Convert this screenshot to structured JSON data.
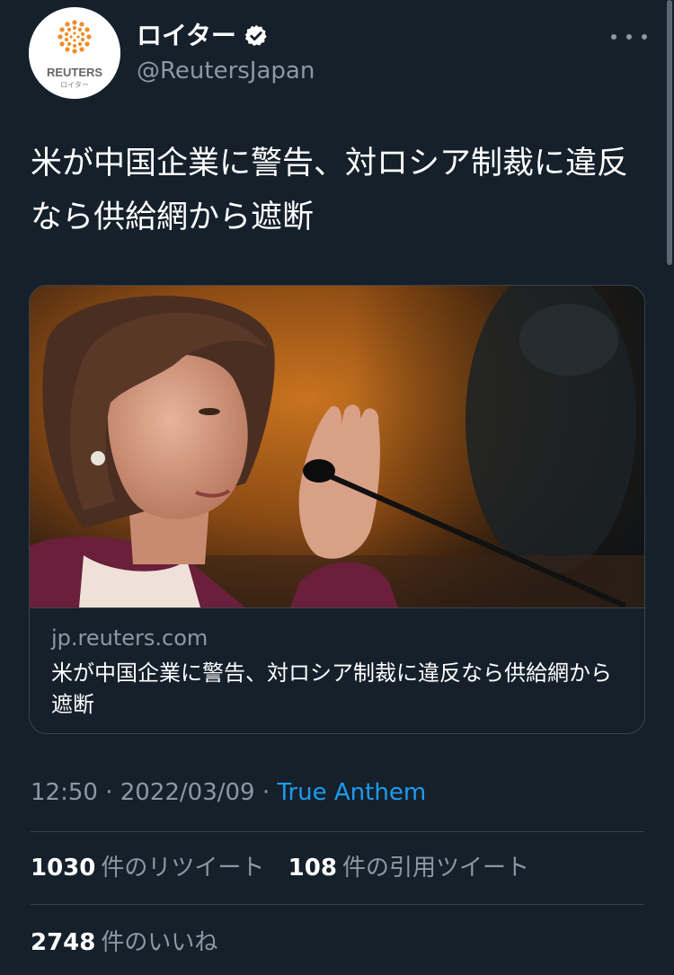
{
  "author": {
    "display_name": "ロイター",
    "handle": "@ReutersJapan",
    "avatar_text": "REUTERS",
    "avatar_subtext": "ロイター",
    "verified_icon": "verified-badge-icon"
  },
  "tweet": {
    "text": "米が中国企業に警告、対ロシア制裁に違反なら供給網から遮断"
  },
  "card": {
    "domain": "jp.reuters.com",
    "title": "米が中国企業に警告、対ロシア制裁に違反なら供給網から遮断"
  },
  "meta": {
    "time": "12:50",
    "sep1": " · ",
    "date": "2022/03/09",
    "sep2": " · ",
    "source": "True Anthem"
  },
  "stats": {
    "retweets_count": "1030",
    "retweets_label": "件のリツイート",
    "quotes_count": "108",
    "quotes_label": "件の引用ツイート",
    "likes_count": "2748",
    "likes_label": "件のいいね"
  },
  "colors": {
    "background": "#15202b",
    "accent": "#1d9bf0",
    "secondary_text": "#8b98a5",
    "border": "#38444d"
  }
}
